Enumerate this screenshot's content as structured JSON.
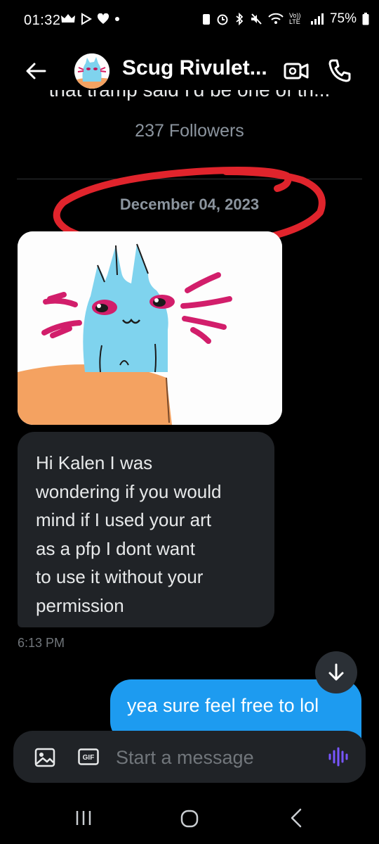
{
  "status_bar": {
    "time": "01:32",
    "battery": "75%",
    "network": "Vo)) LTE"
  },
  "header": {
    "contact_name": "Scug Rivulet...",
    "icons": [
      "back-arrow-icon",
      "video-call-icon",
      "phone-icon"
    ]
  },
  "profile": {
    "bio_cut": "that tramp said I'd be one of th...",
    "followers": "237 Followers"
  },
  "conversation": {
    "date_separator": "December 04, 2023",
    "messages": [
      {
        "direction": "incoming",
        "type": "image"
      },
      {
        "direction": "incoming",
        "type": "text",
        "lines": [
          "Hi Kalen I was",
          "wondering if you would",
          "mind if I used your art",
          "as a pfp I dont want",
          "to use it without your",
          "permission"
        ],
        "time": "6:13 PM"
      },
      {
        "direction": "outgoing",
        "type": "text",
        "text": "yea sure feel free to lol"
      }
    ]
  },
  "composer": {
    "placeholder": "Start a message",
    "gif_label": "GIF"
  },
  "colors": {
    "background": "#000000",
    "incoming_bubble": "#202327",
    "outgoing_bubble": "#1d9bf0",
    "annotation_red": "#e0242c",
    "voice_accent": "#7856ff"
  }
}
